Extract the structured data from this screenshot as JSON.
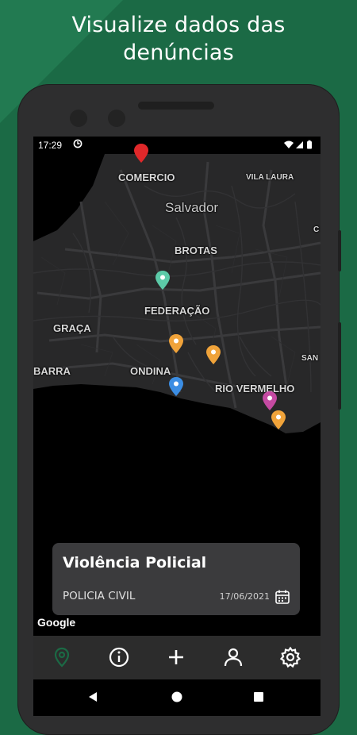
{
  "headline": {
    "line1": "Visualize dados das",
    "line2": "denúncias"
  },
  "status": {
    "time": "17:29"
  },
  "map": {
    "city_label": "Salvador",
    "neighborhoods": [
      "COMERCIO",
      "VILA LAURA",
      "BROTAS",
      "FEDERAÇÃO",
      "GRAÇA",
      "ONDINA",
      "BARRA",
      "RIO VERMELHO",
      "SAN",
      "C"
    ]
  },
  "pins": [
    {
      "name": "pin-teal",
      "color": "#5ccaa8"
    },
    {
      "name": "pin-orange-1",
      "color": "#f0a33a"
    },
    {
      "name": "pin-orange-2",
      "color": "#f0a33a"
    },
    {
      "name": "pin-blue",
      "color": "#3b8de3"
    },
    {
      "name": "pin-magenta",
      "color": "#c44aa2"
    },
    {
      "name": "pin-orange-3",
      "color": "#f0a33a"
    },
    {
      "name": "pin-red",
      "color": "#e0282a"
    }
  ],
  "card": {
    "title": "Violência Policial",
    "agency": "POLICIA CIVIL",
    "date": "17/06/2021"
  },
  "attribution": "Google",
  "colors": {
    "background": "#1b6a45",
    "accent": "#1b6a45",
    "card": "#3b3b3d",
    "nav_active": "#1b6a45"
  },
  "navigation": {
    "items": [
      {
        "icon": "map-pin-icon",
        "active": true
      },
      {
        "icon": "info-icon",
        "active": false
      },
      {
        "icon": "plus-icon",
        "active": false
      },
      {
        "icon": "user-icon",
        "active": false
      },
      {
        "icon": "gear-icon",
        "active": false
      }
    ]
  }
}
